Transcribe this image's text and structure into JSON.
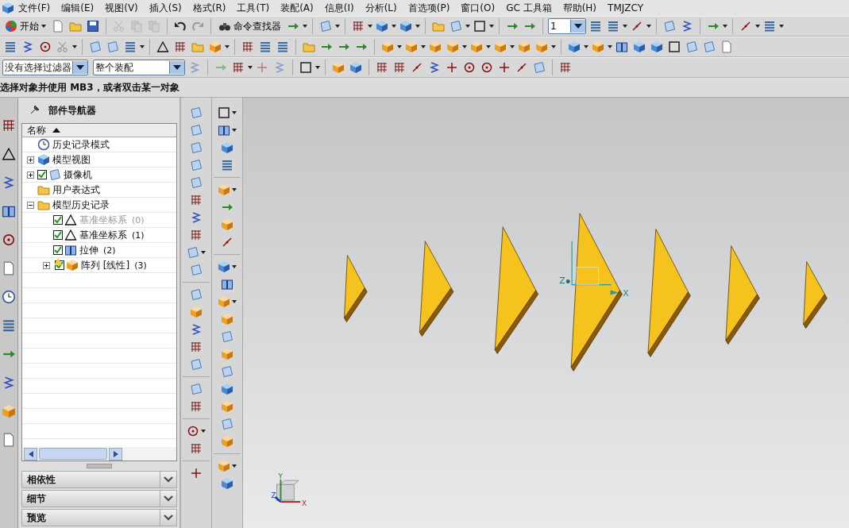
{
  "menu_bar": [
    {
      "label": "文件(F)"
    },
    {
      "label": "编辑(E)"
    },
    {
      "label": "视图(V)"
    },
    {
      "label": "插入(S)"
    },
    {
      "label": "格式(R)"
    },
    {
      "label": "工具(T)"
    },
    {
      "label": "装配(A)"
    },
    {
      "label": "信息(I)"
    },
    {
      "label": "分析(L)"
    },
    {
      "label": "首选项(P)"
    },
    {
      "label": "窗口(O)"
    },
    {
      "label": "GC 工具箱"
    },
    {
      "label": "帮助(H)"
    },
    {
      "label": "TMJZCY"
    }
  ],
  "toolbar": {
    "start_button": "开始",
    "command_finder": "命令查找器",
    "layer_field": {
      "value": "1"
    }
  },
  "selection_bar": {
    "filter": {
      "value": "没有选择过滤器"
    },
    "scope": {
      "value": "整个装配"
    }
  },
  "cue_line": "选择对象并使用 MB3，或者双击某一对象",
  "part_navigator": {
    "title": "部件导航器",
    "column": "名称",
    "tree": [
      {
        "label": "历史记录模式",
        "kind": "mode"
      },
      {
        "label": "模型视图",
        "kind": "view",
        "expanded": false
      },
      {
        "label": "摄像机",
        "kind": "camera",
        "expanded": false,
        "checked": true
      },
      {
        "label": "用户表达式",
        "kind": "expressions"
      },
      {
        "label": "模型历史记录",
        "kind": "history",
        "expanded": true,
        "children": [
          {
            "label": "基准坐标系",
            "index": "(0)",
            "kind": "datum",
            "checked": true,
            "disabled": true
          },
          {
            "label": "基准坐标系",
            "index": "(1)",
            "kind": "datum",
            "checked": true,
            "disabled": false
          },
          {
            "label": "拉伸",
            "index": "(2)",
            "kind": "extrude",
            "checked": true,
            "disabled": false
          },
          {
            "label": "阵列 [线性]",
            "index": "(3)",
            "kind": "pattern",
            "checked": true,
            "disabled": false,
            "expanded": false,
            "warning": true
          }
        ]
      }
    ]
  },
  "panels": [
    {
      "label": "相依性",
      "expanded": false
    },
    {
      "label": "细节",
      "expanded": false
    },
    {
      "label": "预览",
      "expanded": false
    }
  ],
  "graphics": {
    "work_coordinate_system": {
      "x_label": "X",
      "z_label": "Z"
    },
    "view_triad": {
      "x_label": "X",
      "y_label": "Y",
      "z_label": "Z"
    }
  }
}
